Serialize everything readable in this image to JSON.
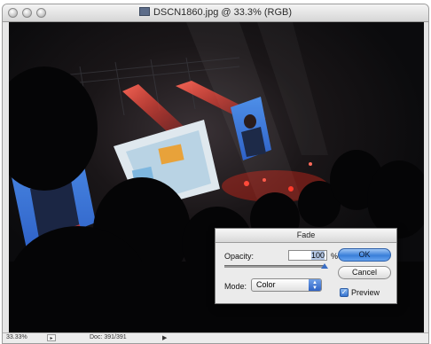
{
  "window": {
    "title": "DSCN1860.jpg @ 33.3% (RGB)"
  },
  "status_bar": {
    "zoom": "33.33%",
    "doc_info": "Doc: 391/391"
  },
  "fade_dialog": {
    "title": "Fade",
    "opacity_label": "Opacity:",
    "opacity_value": "100",
    "percent_sign": "%",
    "opacity_slider_fraction": 1.0,
    "mode_label": "Mode:",
    "mode_value": "Color",
    "ok_label": "OK",
    "cancel_label": "Cancel",
    "preview_label": "Preview",
    "preview_checked": true
  },
  "colors": {
    "accent": "#3a7fd9",
    "canvas_background": "#0d0d10",
    "stage_light": "#ff2a1a"
  },
  "icons": {
    "close": "traffic-light-close",
    "minimize": "traffic-light-minimize",
    "zoom": "traffic-light-zoom",
    "document": "document-icon",
    "checkbox": "checkmark-icon",
    "select": "updown-arrows-icon"
  }
}
